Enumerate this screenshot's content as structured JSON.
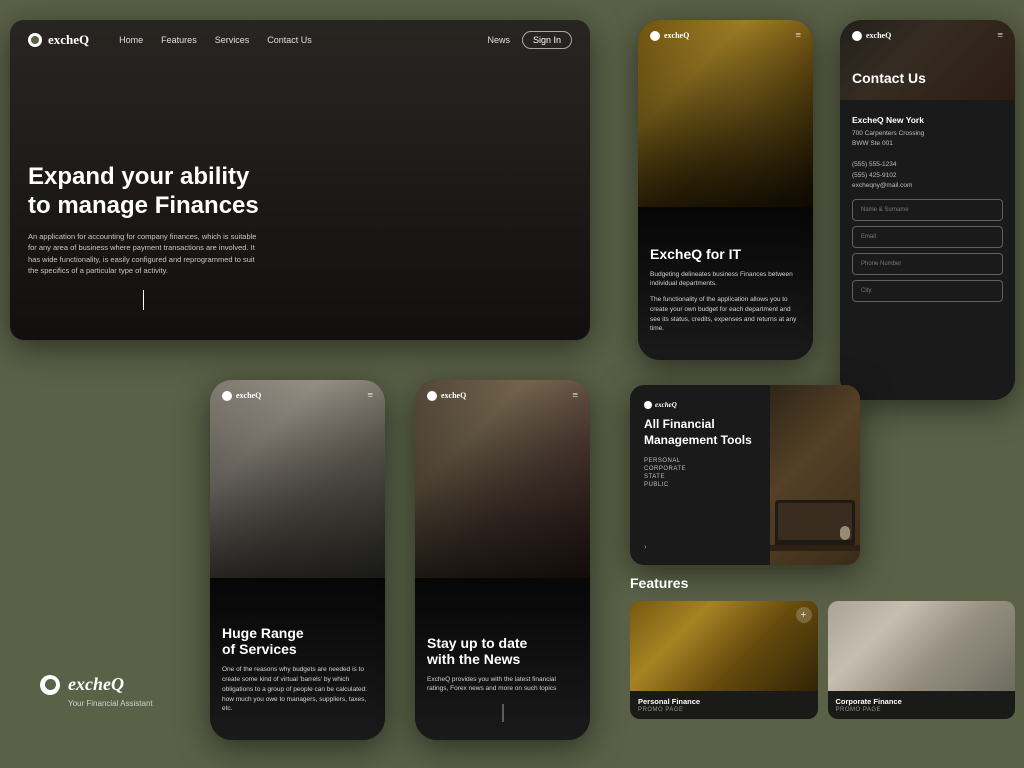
{
  "brand": {
    "name": "excheQ",
    "tagline": "Your Financial Assistant"
  },
  "hero": {
    "nav": {
      "home": "Home",
      "features": "Features",
      "services": "Services",
      "contact_us": "Contact Us",
      "news": "News",
      "sign_in": "Sign In"
    },
    "title_line1": "Expand your ability",
    "title_line2": "to manage Finances",
    "description": "An application for accounting for company finances, which is suitable for any area of business where payment transactions are involved. It has wide functionality, is easily configured and reprogrammed to suit the specifics of a particular type of activity."
  },
  "phone_it": {
    "nav_brand": "excheQ",
    "title": "ExcheQ for IT",
    "desc1": "Budgeting delineates business Finances between individual departments.",
    "desc2": "The functionality of the application allows you to create your own budget for each department and see its status, credits, expenses and returns at any time."
  },
  "phone_contact": {
    "nav_brand": "excheQ",
    "page_title": "Contact Us",
    "office_name": "ExcheQ New York",
    "address_line1": "700 Carpenters Crossing",
    "address_line2": "BWW Ste 001",
    "phone1": "(555) 555-1234",
    "phone2": "(555) 425-9102",
    "email": "excheqny@mail.com",
    "fields": [
      "Name & Surname",
      "Email",
      "Phone Number",
      "City"
    ]
  },
  "phone_services": {
    "nav_brand": "excheQ",
    "title_line1": "Huge Range",
    "title_line2": "of Services",
    "description": "One of the reasons why budgets are needed is to create some kind of virtual 'barrels' by which obligations to a group of people can be calculated: how much you owe to managers, suppliers, taxes, etc."
  },
  "phone_news": {
    "nav_brand": "excheQ",
    "title_line1": "Stay up to date",
    "title_line2": "with the News",
    "description": "ExcheQ provides you with the latest financial ratings, Forex news and more on such topics"
  },
  "financial_tools": {
    "brand": "excheQ",
    "title_line1": "All Financial",
    "title_line2": "Management Tools",
    "tags": [
      "PERSONAL",
      "CORPORATE",
      "STATE",
      "PUBLIC"
    ]
  },
  "features": {
    "section_title": "Features",
    "cards": [
      {
        "name": "Personal Finance",
        "type": "PROMO PAGE"
      },
      {
        "name": "Corporate Finance",
        "type": "PROMO PAGE"
      }
    ]
  }
}
